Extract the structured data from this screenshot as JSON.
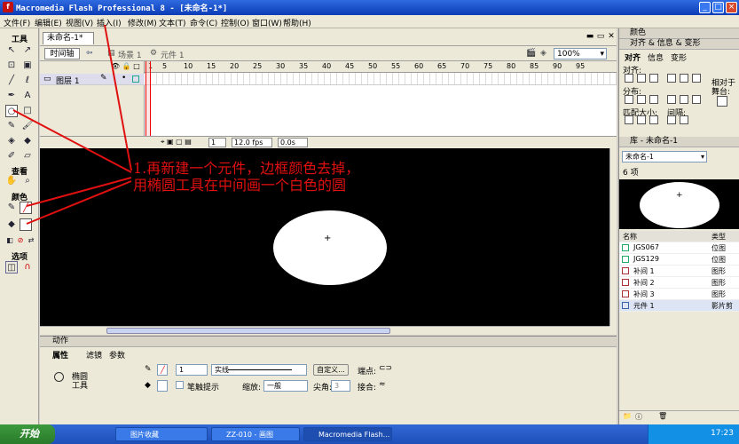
{
  "window": {
    "title": "Macromedia Flash Professional 8 - [未命名-1*]",
    "buttons": [
      "_",
      "□",
      "×"
    ]
  },
  "menu": [
    "文件(F)",
    "编辑(E)",
    "视图(V)",
    "插入(I)",
    "修改(M)",
    "文本(T)",
    "命令(C)",
    "控制(O)",
    "窗口(W)",
    "帮助(H)"
  ],
  "tools": {
    "title": "工具",
    "view_label": "查看",
    "color_label": "颜色",
    "options_label": "选项"
  },
  "document": {
    "tab": "未命名-1*",
    "timeline_button": "时间轴",
    "breadcrumb_scene": "场景 1",
    "breadcrumb_symbol": "元件 1",
    "zoom": "100%",
    "layer_name": "图层 1",
    "ruler": [
      "1",
      "5",
      "10",
      "15",
      "20",
      "25",
      "30",
      "35",
      "40",
      "45",
      "50",
      "55",
      "60",
      "65",
      "70",
      "75",
      "80",
      "85",
      "90",
      "95"
    ],
    "status_frame": "1",
    "status_fps": "12.0 fps",
    "status_time": "0.0s"
  },
  "annotation": {
    "line1": "1.再新建一个元件，边框颜色去掉，",
    "line2": "用椭圆工具在中间画一个白色的圆"
  },
  "properties": {
    "actions_bar": "动作",
    "tabs": [
      "属性",
      "滤镜",
      "参数"
    ],
    "tool_name_1": "椭圆",
    "tool_name_2": "工具",
    "stroke_size": "1",
    "stroke_style": "实线",
    "custom_button": "自定义...",
    "endpoint_label": "端点:",
    "hinting_label": "笔触提示",
    "scale_label": "缩放:",
    "scale_value": "一般",
    "miter_label": "尖角:",
    "miter_value": "3",
    "join_label": "接合:"
  },
  "right_panel": {
    "color_header": "颜色",
    "align_header": "对齐 & 信息 & 变形",
    "align_tabs": [
      "对齐",
      "信息",
      "变形"
    ],
    "align_label": "对齐:",
    "distribute_label": "分布:",
    "match_size_label": "匹配大小:",
    "spacing_label": "间隔:",
    "relative_label_1": "相对于",
    "relative_label_2": "舞台:",
    "library_header": "库 - 未命名-1",
    "library_doc": "未命名-1",
    "item_count": "6 项",
    "columns": [
      "名称",
      "类型"
    ],
    "items": [
      {
        "name": "JGS067",
        "type": "位图"
      },
      {
        "name": "JGS129",
        "type": "位图"
      },
      {
        "name": "补间 1",
        "type": "图形"
      },
      {
        "name": "补间 2",
        "type": "图形"
      },
      {
        "name": "补间 3",
        "type": "图形"
      },
      {
        "name": "元件 1",
        "type": "影片剪"
      }
    ]
  },
  "taskbar": {
    "start": "开始",
    "tasks": [
      "图片收藏",
      "ZZ-010 - 画图",
      "Macromedia Flash..."
    ],
    "clock": "17:23"
  },
  "colors": {
    "annotation": "#e01010",
    "stage": "#000000",
    "shape_fill": "#ffffff"
  }
}
